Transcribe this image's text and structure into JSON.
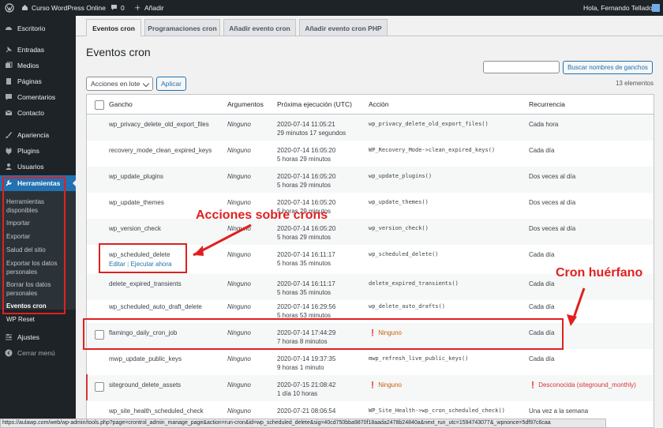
{
  "admin_bar": {
    "wp_logo": "wordpress-icon",
    "site_name": "Curso WordPress Online",
    "comments_count": "0",
    "new_label": "Añadir",
    "greeting": "Hola, Fernando Tellado"
  },
  "sidebar": {
    "items": [
      {
        "label": "Escritorio",
        "icon": "dashboard-icon"
      },
      {
        "label": "Entradas",
        "icon": "pin-icon"
      },
      {
        "label": "Medios",
        "icon": "media-icon"
      },
      {
        "label": "Páginas",
        "icon": "page-icon"
      },
      {
        "label": "Comentarios",
        "icon": "comment-icon"
      },
      {
        "label": "Contacto",
        "icon": "mail-icon"
      },
      {
        "label": "Apariencia",
        "icon": "brush-icon"
      },
      {
        "label": "Plugins",
        "icon": "plugin-icon"
      },
      {
        "label": "Usuarios",
        "icon": "user-icon"
      },
      {
        "label": "Herramientas",
        "icon": "wrench-icon"
      }
    ],
    "submenu": [
      "Herramientas disponibles",
      "Importar",
      "Exportar",
      "Salud del sitio",
      "Exportar los datos personales",
      "Borrar los datos personales",
      "Eventos cron"
    ],
    "wp_reset": "WP Reset",
    "ajustes": "Ajustes",
    "collapse": "Cerrar menú"
  },
  "tabs": [
    "Eventos cron",
    "Programaciones cron",
    "Añadir evento cron",
    "Añadir evento cron PHP"
  ],
  "page_title": "Eventos cron",
  "search": {
    "placeholder": "",
    "button": "Buscar nombres de ganchos"
  },
  "bulk": {
    "selected": "Acciones en lote",
    "apply": "Aplicar"
  },
  "count_label": "13 elementos",
  "columns": [
    "Gancho",
    "Argumentos",
    "Próxima ejecución (UTC)",
    "Acción",
    "Recurrencia"
  ],
  "rows": [
    {
      "hook": "wp_privacy_delete_old_export_files",
      "args": "Ninguno",
      "next": "2020-07-14 11:05:21",
      "rel": "29 minutos 17 segundos",
      "action": "wp_privacy_delete_old_export_files()",
      "rec": "Cada hora"
    },
    {
      "hook": "recovery_mode_clean_expired_keys",
      "args": "Ninguno",
      "next": "2020-07-14 16:05:20",
      "rel": "5 horas 29 minutos",
      "action": "WP_Recovery_Mode->clean_expired_keys()",
      "rec": "Cada día"
    },
    {
      "hook": "wp_update_plugins",
      "args": "Ninguno",
      "next": "2020-07-14 16:05:20",
      "rel": "5 horas 29 minutos",
      "action": "wp_update_plugins()",
      "rec": "Dos veces al día"
    },
    {
      "hook": "wp_update_themes",
      "args": "Ninguno",
      "next": "2020-07-14 16:05:20",
      "rel": "5 horas 29 minutos",
      "action": "wp_update_themes()",
      "rec": "Dos veces al día"
    },
    {
      "hook": "wp_version_check",
      "args": "Ninguno",
      "next": "2020-07-14 16:05:20",
      "rel": "5 horas 29 minutos",
      "action": "wp_version_check()",
      "rec": "Dos veces al día"
    },
    {
      "hook": "wp_scheduled_delete",
      "args": "Ninguno",
      "next": "2020-07-14 16:11:17",
      "rel": "5 horas 35 minutos",
      "action": "wp_scheduled_delete()",
      "rec": "Cada día",
      "row_actions": [
        "Editar",
        "Ejecutar ahora"
      ]
    },
    {
      "hook": "delete_expired_transients",
      "args": "Ninguno",
      "next": "2020-07-14 16:11:17",
      "rel": "5 horas 35 minutos",
      "action": "delete_expired_transients()",
      "rec": "Cada día"
    },
    {
      "hook": "wp_scheduled_auto_draft_delete",
      "args": "Ninguno",
      "next": "2020-07-14 16:29:56",
      "rel": "5 horas 53 minutos",
      "action": "wp_delete_auto_drafts()",
      "rec": "Cada día"
    },
    {
      "hook": "flamingo_daily_cron_job",
      "args": "Ninguno",
      "next": "2020-07-14 17:44:29",
      "rel": "7 horas 8 minutos",
      "action": "Ninguno",
      "rec": "Cada día"
    },
    {
      "hook": "mwp_update_public_keys",
      "args": "Ninguno",
      "next": "2020-07-14 19:37:35",
      "rel": "9 horas 1 minuto",
      "action": "mwp_refresh_live_public_keys()",
      "rec": "Cada día"
    },
    {
      "hook": "siteground_delete_assets",
      "args": "Ninguno",
      "next": "2020-07-15 21:08:42",
      "rel": "1 día 10 horas",
      "action": "Ninguno",
      "rec": "Desconocida (siteground_monthly)"
    },
    {
      "hook": "wp_site_health_scheduled_check",
      "args": "Ninguno",
      "next": "2020-07-21 08:06:54",
      "rel": "",
      "action": "WP_Site_Health->wp_cron_scheduled_check()",
      "rec": "Una vez a la semana"
    }
  ],
  "annotations": {
    "actions": "Acciones sobre crons",
    "orphan": "Cron huérfano"
  },
  "status_url": "https://aulawp.com/web/wp-admin/tools.php?page=crontrol_admin_manage_page&action=run-cron&id=wp_scheduled_delete&sig=40cd750bba9870f18aada2478b24840a&next_run_utc=1594743077&_wpnonce=5df97c6caa",
  "colors": {
    "admin_bar": "#1d2327",
    "accent": "#2271b1",
    "annotation": "#e02020",
    "warning": "#d63638"
  }
}
